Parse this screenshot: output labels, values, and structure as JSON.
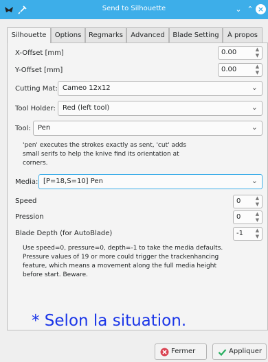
{
  "window": {
    "title": "Send to Silhouette"
  },
  "tabs": [
    {
      "label": "Silhouette"
    },
    {
      "label": "Options"
    },
    {
      "label": "Regmarks"
    },
    {
      "label": "Advanced"
    },
    {
      "label": "Blade Setting"
    },
    {
      "label": "À propos"
    }
  ],
  "fields": {
    "x_offset": {
      "label": "X-Offset [mm]",
      "value": "0.00"
    },
    "y_offset": {
      "label": "Y-Offset [mm]",
      "value": "0.00"
    },
    "cutting_mat": {
      "label": "Cutting Mat:",
      "value": "Cameo 12x12"
    },
    "tool_holder": {
      "label": "Tool Holder:",
      "value": "Red (left tool)"
    },
    "tool": {
      "label": "Tool:",
      "value": "Pen"
    },
    "tool_note": "'pen' executes the strokes exactly as sent, 'cut' adds small serifs to help the knive find its orientation at corners.",
    "media": {
      "label": "Media:",
      "value": "[P=18,S=10] Pen"
    },
    "speed": {
      "label": "Speed",
      "value": "0"
    },
    "pression": {
      "label": "Pression",
      "value": "0"
    },
    "blade_depth": {
      "label": "Blade Depth (for AutoBlade)",
      "value": "-1"
    },
    "defaults_note": "Use speed=0, pressure=0, depth=-1 to take the media defaults. Pressure values of 19 or more could trigger the trackenhancing feature, which means a movement along the full media height before start. Beware."
  },
  "annotation": "* Selon la situation.",
  "buttons": {
    "close": "Fermer",
    "apply": "Appliquer"
  },
  "colors": {
    "titlebar": "#3daee9",
    "annotation": "#1a35e8",
    "focus": "#3daee9"
  }
}
